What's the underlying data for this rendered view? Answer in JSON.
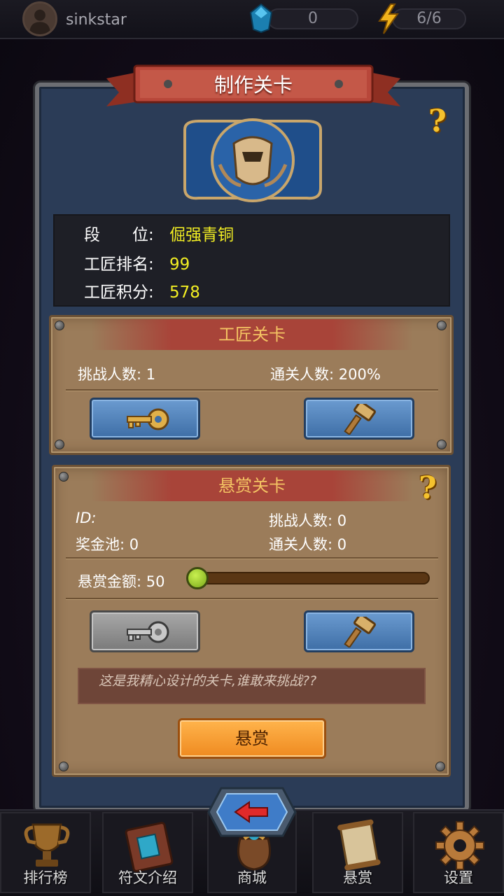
{
  "top_bar": {
    "username": "sinkstar",
    "gems": "0",
    "energy": "6/6"
  },
  "panel": {
    "title": "制作关卡",
    "help_icon": "?"
  },
  "stats": {
    "rank_label": "段　　位:",
    "rank_value": "倔强青铜",
    "craft_rank_label": "工匠排名:",
    "craft_rank_value": "99",
    "craft_points_label": "工匠积分:",
    "craft_points_value": "578"
  },
  "craft_levels": {
    "header": "工匠关卡",
    "challengers": "挑战人数: 1",
    "clear_rate": "通关人数: 200%",
    "buttons": [
      {
        "icon": "key-icon"
      },
      {
        "icon": "hammer-icon"
      }
    ]
  },
  "bounty_levels": {
    "header": "悬赏关卡",
    "help_icon": "?",
    "id_label": "ID:",
    "challengers": "挑战人数: 0",
    "prize_pool": "奖金池:  0",
    "clears": "通关人数: 0",
    "bounty_amount": "悬赏金额: 50",
    "slider_fraction": 0.0,
    "message": "这是我精心设计的关卡,谁敢来挑战??",
    "reward_button": "悬赏"
  },
  "bottom_nav": [
    {
      "label": "排行榜",
      "icon": "trophy-icon"
    },
    {
      "label": "符文介绍",
      "icon": "rune-book-icon"
    },
    {
      "label": "商城",
      "icon": "bag-icon"
    },
    {
      "label": "悬赏",
      "icon": "scroll-icon"
    },
    {
      "label": "设置",
      "icon": "gear-icon"
    }
  ],
  "colors": {
    "accent_yellow": "#f2ee23",
    "panel_blue": "#2b3c57",
    "wood": "#9b7c5a",
    "ribbon_red": "#a84439",
    "orange_button": "#ef8a20"
  }
}
